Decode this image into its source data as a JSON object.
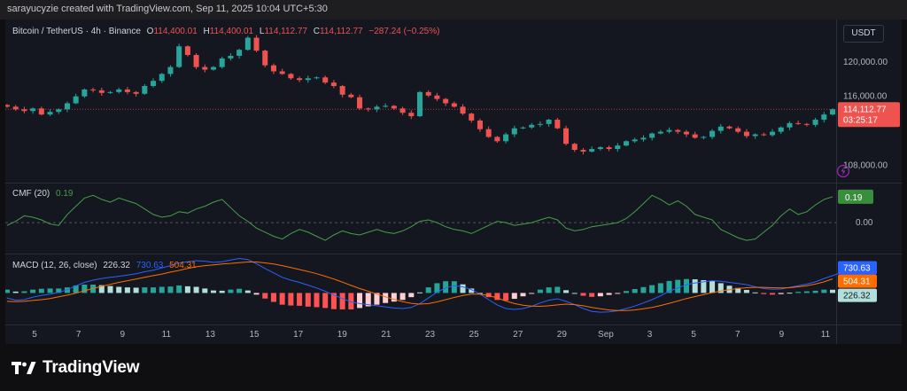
{
  "watermark": "sarayucyzie created with TradingView.com, Sep 11, 2025 10:04 UTC+5:30",
  "brand": "TradingView",
  "currency_button": "USDT",
  "symbol": {
    "name": "Bitcoin / TetherUS · 4h · Binance",
    "o_label": "O",
    "o_value": "114,400.01",
    "h_label": "H",
    "h_value": "114,400.01",
    "l_label": "L",
    "l_value": "114,112.77",
    "c_label": "C",
    "c_value": "114,112.77",
    "change": "−287.24 (−0.25%)"
  },
  "price_tag": {
    "value": "114,112.77",
    "countdown": "03:25:17"
  },
  "cmf": {
    "label": "CMF (20)",
    "value": "0.19"
  },
  "macd": {
    "label": "MACD (12, 26, close)",
    "hist": "226.32",
    "macd": "730.63",
    "signal": "504.31"
  },
  "colors": {
    "up": "#26a69a",
    "down": "#ef5350",
    "cmf_line": "#43a047",
    "macd_line": "#2962ff",
    "signal_line": "#ff6d00",
    "bg": "#141720"
  },
  "chart_data": [
    {
      "type": "line",
      "title": "Bitcoin / TetherUS · 4h · Binance",
      "ylim": [
        106000,
        124500
      ],
      "y_ticks": [
        "120,000.00",
        "116,000.00",
        "108,000.00"
      ],
      "x_ticks": [
        "5",
        "7",
        "9",
        "11",
        "13",
        "15",
        "17",
        "19",
        "21",
        "23",
        "25",
        "27",
        "29",
        "Sep",
        "3",
        "5",
        "7",
        "9",
        "11"
      ],
      "series": [
        {
          "values": [
            114800,
            114500,
            114300,
            114600,
            113900,
            114200,
            114500,
            115200,
            116000,
            116800,
            116700,
            116400,
            116500,
            116800,
            116500,
            116300,
            117200,
            117800,
            118600,
            119400,
            121800,
            120800,
            119400,
            119100,
            119400,
            120400,
            120700,
            121400,
            122800,
            121300,
            119600,
            118900,
            118600,
            118100,
            117900,
            118100,
            118200,
            117600,
            117200,
            116200,
            115900,
            114600,
            114500,
            114800,
            114900,
            114600,
            114100,
            113700,
            116500,
            116100,
            115700,
            115200,
            114800,
            114000,
            113200,
            112200,
            111300,
            110800,
            111600,
            112300,
            112400,
            112700,
            112800,
            113300,
            112300,
            110500,
            109800,
            109600,
            109900,
            110100,
            109900,
            110300,
            110800,
            111000,
            111200,
            111700,
            111900,
            112100,
            111900,
            111600,
            111200,
            111300,
            112000,
            112500,
            112300,
            111900,
            111400,
            111600,
            111500,
            111900,
            112400,
            112900,
            112800,
            112700,
            113300,
            113900,
            114500
          ]
        }
      ]
    },
    {
      "type": "line",
      "title": "CMF (20)",
      "ylim": [
        -0.22,
        0.28
      ],
      "y_ticks": [
        "0.00"
      ],
      "series": [
        {
          "name": "CMF (20)",
          "values": [
            -0.02,
            0.01,
            0.05,
            0.04,
            0.02,
            -0.01,
            -0.02,
            0.06,
            0.12,
            0.18,
            0.2,
            0.17,
            0.15,
            0.18,
            0.16,
            0.14,
            0.1,
            0.06,
            0.04,
            0.05,
            0.08,
            0.07,
            0.1,
            0.12,
            0.15,
            0.17,
            0.11,
            0.05,
            0.01,
            -0.04,
            -0.07,
            -0.1,
            -0.12,
            -0.08,
            -0.05,
            -0.07,
            -0.1,
            -0.13,
            -0.09,
            -0.06,
            -0.08,
            -0.09,
            -0.07,
            -0.05,
            -0.07,
            -0.08,
            -0.06,
            -0.03,
            0.01,
            0.02,
            0.0,
            -0.03,
            -0.05,
            -0.06,
            -0.08,
            -0.05,
            -0.02,
            0.01,
            0.0,
            -0.02,
            -0.01,
            0.0,
            0.02,
            0.04,
            0.02,
            -0.04,
            -0.06,
            -0.05,
            -0.03,
            -0.02,
            -0.01,
            0.0,
            0.03,
            0.08,
            0.14,
            0.2,
            0.17,
            0.13,
            0.16,
            0.12,
            0.06,
            0.04,
            0.02,
            -0.05,
            -0.08,
            -0.11,
            -0.13,
            -0.12,
            -0.07,
            -0.02,
            0.05,
            0.1,
            0.06,
            0.08,
            0.13,
            0.17,
            0.19
          ]
        }
      ]
    },
    {
      "type": "bar",
      "title": "MACD (12, 26, close)",
      "series": [
        {
          "name": "MACD",
          "values": [
            -180,
            -260,
            -240,
            -150,
            -90,
            -40,
            20,
            120,
            260,
            380,
            460,
            520,
            560,
            600,
            640,
            690,
            760,
            820,
            900,
            980,
            1080,
            1120,
            1160,
            1140,
            1100,
            1120,
            1180,
            1240,
            1200,
            1050,
            880,
            720,
            560,
            460,
            380,
            280,
            180,
            60,
            -80,
            -200,
            -320,
            -380,
            -420,
            -460,
            -500,
            -540,
            -560,
            -520,
            -380,
            -180,
            30,
            180,
            260,
            220,
            120,
            -40,
            -240,
            -430,
            -560,
            -590,
            -560,
            -480,
            -360,
            -260,
            -210,
            -300,
            -420,
            -560,
            -660,
            -690,
            -680,
            -640,
            -560,
            -470,
            -360,
            -240,
            -100,
            60,
            180,
            300,
            360,
            400,
            440,
            420,
            380,
            340,
            300,
            220,
            160,
            130,
            140,
            200,
            260,
            320,
            400,
            520,
            620,
            730.63
          ]
        },
        {
          "name": "Signal",
          "values": [
            -300,
            -310,
            -300,
            -270,
            -240,
            -200,
            -140,
            -80,
            -10,
            80,
            160,
            240,
            310,
            380,
            440,
            500,
            560,
            620,
            680,
            750,
            810,
            880,
            940,
            980,
            1010,
            1040,
            1060,
            1090,
            1110,
            1110,
            1080,
            1040,
            980,
            910,
            840,
            770,
            690,
            600,
            500,
            390,
            270,
            160,
            60,
            -40,
            -140,
            -230,
            -310,
            -370,
            -400,
            -380,
            -320,
            -240,
            -160,
            -90,
            -40,
            -40,
            -90,
            -180,
            -290,
            -380,
            -440,
            -470,
            -480,
            -460,
            -430,
            -400,
            -420,
            -460,
            -520,
            -570,
            -610,
            -630,
            -630,
            -610,
            -570,
            -520,
            -450,
            -370,
            -290,
            -200,
            -130,
            -60,
            10,
            70,
            120,
            160,
            190,
            200,
            200,
            190,
            180,
            190,
            220,
            260,
            320,
            400,
            504.31
          ]
        }
      ]
    }
  ]
}
